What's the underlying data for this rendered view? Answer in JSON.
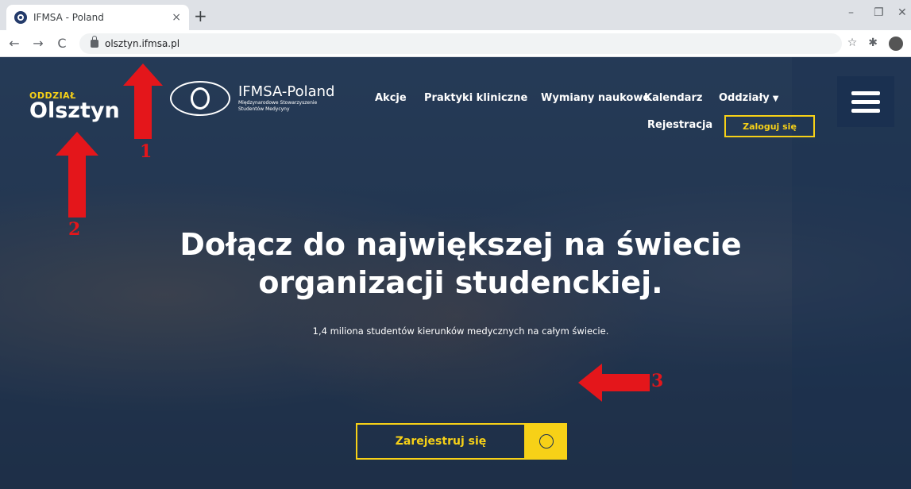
{
  "browser": {
    "tab_title": "IFMSA - Poland",
    "tab_close": "×",
    "new_tab": "+",
    "url": "olsztyn.ifmsa.pl",
    "win_min": "–",
    "win_max": "❐",
    "win_close": "✕"
  },
  "site": {
    "branch_label": "ODDZIAŁ",
    "branch_name": "Olsztyn",
    "brand_name": "IFMSA-Poland",
    "brand_sub": "Międzynarodowe Stowarzyszenie Studentów Medycyny",
    "nav": {
      "akcje": "Akcje",
      "praktyki": "Praktyki kliniczne",
      "wymiany": "Wymiany naukowe",
      "kalendarz": "Kalendarz",
      "oddzialy": "Oddziały",
      "rejestracja": "Rejestracja",
      "zaloguj": "Zaloguj się"
    },
    "headline_1": "Dołącz do największej na świecie",
    "headline_2": "organizacji studenckiej.",
    "subline": "1,4 miliona studentów kierunków medycznych na całym świecie.",
    "cta": "Zarejestruj się"
  },
  "annotations": {
    "num_1": "1",
    "num_2": "2",
    "num_3": "3"
  },
  "colors": {
    "accent": "#f7d117",
    "arrow": "#e4161b",
    "navy": "#1a3050"
  }
}
